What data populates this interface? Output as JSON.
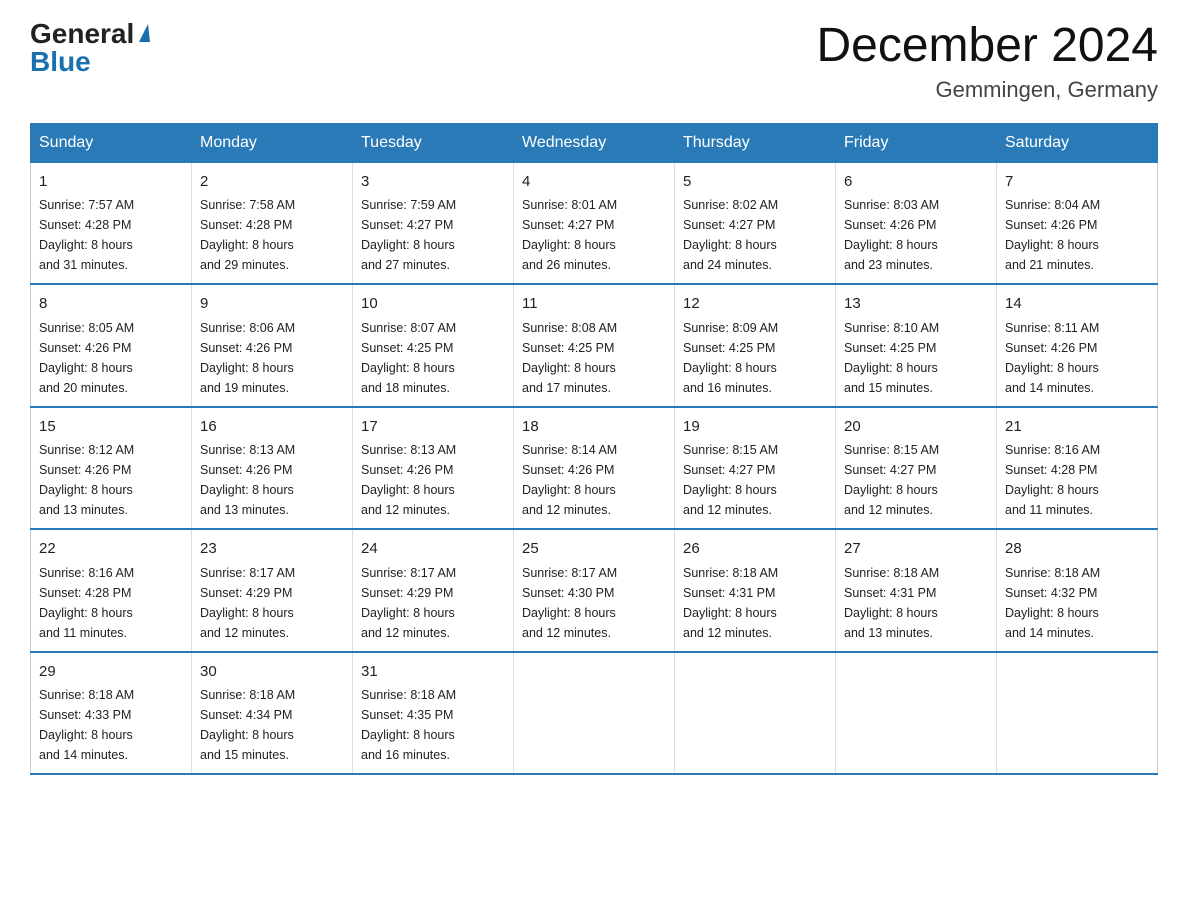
{
  "logo": {
    "general": "General",
    "blue": "Blue",
    "triangle": "▲"
  },
  "header": {
    "month_year": "December 2024",
    "location": "Gemmingen, Germany"
  },
  "days_of_week": [
    "Sunday",
    "Monday",
    "Tuesday",
    "Wednesday",
    "Thursday",
    "Friday",
    "Saturday"
  ],
  "weeks": [
    [
      {
        "day": "1",
        "sunrise": "7:57 AM",
        "sunset": "4:28 PM",
        "daylight": "8 hours and 31 minutes."
      },
      {
        "day": "2",
        "sunrise": "7:58 AM",
        "sunset": "4:28 PM",
        "daylight": "8 hours and 29 minutes."
      },
      {
        "day": "3",
        "sunrise": "7:59 AM",
        "sunset": "4:27 PM",
        "daylight": "8 hours and 27 minutes."
      },
      {
        "day": "4",
        "sunrise": "8:01 AM",
        "sunset": "4:27 PM",
        "daylight": "8 hours and 26 minutes."
      },
      {
        "day": "5",
        "sunrise": "8:02 AM",
        "sunset": "4:27 PM",
        "daylight": "8 hours and 24 minutes."
      },
      {
        "day": "6",
        "sunrise": "8:03 AM",
        "sunset": "4:26 PM",
        "daylight": "8 hours and 23 minutes."
      },
      {
        "day": "7",
        "sunrise": "8:04 AM",
        "sunset": "4:26 PM",
        "daylight": "8 hours and 21 minutes."
      }
    ],
    [
      {
        "day": "8",
        "sunrise": "8:05 AM",
        "sunset": "4:26 PM",
        "daylight": "8 hours and 20 minutes."
      },
      {
        "day": "9",
        "sunrise": "8:06 AM",
        "sunset": "4:26 PM",
        "daylight": "8 hours and 19 minutes."
      },
      {
        "day": "10",
        "sunrise": "8:07 AM",
        "sunset": "4:25 PM",
        "daylight": "8 hours and 18 minutes."
      },
      {
        "day": "11",
        "sunrise": "8:08 AM",
        "sunset": "4:25 PM",
        "daylight": "8 hours and 17 minutes."
      },
      {
        "day": "12",
        "sunrise": "8:09 AM",
        "sunset": "4:25 PM",
        "daylight": "8 hours and 16 minutes."
      },
      {
        "day": "13",
        "sunrise": "8:10 AM",
        "sunset": "4:25 PM",
        "daylight": "8 hours and 15 minutes."
      },
      {
        "day": "14",
        "sunrise": "8:11 AM",
        "sunset": "4:26 PM",
        "daylight": "8 hours and 14 minutes."
      }
    ],
    [
      {
        "day": "15",
        "sunrise": "8:12 AM",
        "sunset": "4:26 PM",
        "daylight": "8 hours and 13 minutes."
      },
      {
        "day": "16",
        "sunrise": "8:13 AM",
        "sunset": "4:26 PM",
        "daylight": "8 hours and 13 minutes."
      },
      {
        "day": "17",
        "sunrise": "8:13 AM",
        "sunset": "4:26 PM",
        "daylight": "8 hours and 12 minutes."
      },
      {
        "day": "18",
        "sunrise": "8:14 AM",
        "sunset": "4:26 PM",
        "daylight": "8 hours and 12 minutes."
      },
      {
        "day": "19",
        "sunrise": "8:15 AM",
        "sunset": "4:27 PM",
        "daylight": "8 hours and 12 minutes."
      },
      {
        "day": "20",
        "sunrise": "8:15 AM",
        "sunset": "4:27 PM",
        "daylight": "8 hours and 12 minutes."
      },
      {
        "day": "21",
        "sunrise": "8:16 AM",
        "sunset": "4:28 PM",
        "daylight": "8 hours and 11 minutes."
      }
    ],
    [
      {
        "day": "22",
        "sunrise": "8:16 AM",
        "sunset": "4:28 PM",
        "daylight": "8 hours and 11 minutes."
      },
      {
        "day": "23",
        "sunrise": "8:17 AM",
        "sunset": "4:29 PM",
        "daylight": "8 hours and 12 minutes."
      },
      {
        "day": "24",
        "sunrise": "8:17 AM",
        "sunset": "4:29 PM",
        "daylight": "8 hours and 12 minutes."
      },
      {
        "day": "25",
        "sunrise": "8:17 AM",
        "sunset": "4:30 PM",
        "daylight": "8 hours and 12 minutes."
      },
      {
        "day": "26",
        "sunrise": "8:18 AM",
        "sunset": "4:31 PM",
        "daylight": "8 hours and 12 minutes."
      },
      {
        "day": "27",
        "sunrise": "8:18 AM",
        "sunset": "4:31 PM",
        "daylight": "8 hours and 13 minutes."
      },
      {
        "day": "28",
        "sunrise": "8:18 AM",
        "sunset": "4:32 PM",
        "daylight": "8 hours and 14 minutes."
      }
    ],
    [
      {
        "day": "29",
        "sunrise": "8:18 AM",
        "sunset": "4:33 PM",
        "daylight": "8 hours and 14 minutes."
      },
      {
        "day": "30",
        "sunrise": "8:18 AM",
        "sunset": "4:34 PM",
        "daylight": "8 hours and 15 minutes."
      },
      {
        "day": "31",
        "sunrise": "8:18 AM",
        "sunset": "4:35 PM",
        "daylight": "8 hours and 16 minutes."
      },
      null,
      null,
      null,
      null
    ]
  ],
  "labels": {
    "sunrise": "Sunrise:",
    "sunset": "Sunset:",
    "daylight": "Daylight:"
  }
}
